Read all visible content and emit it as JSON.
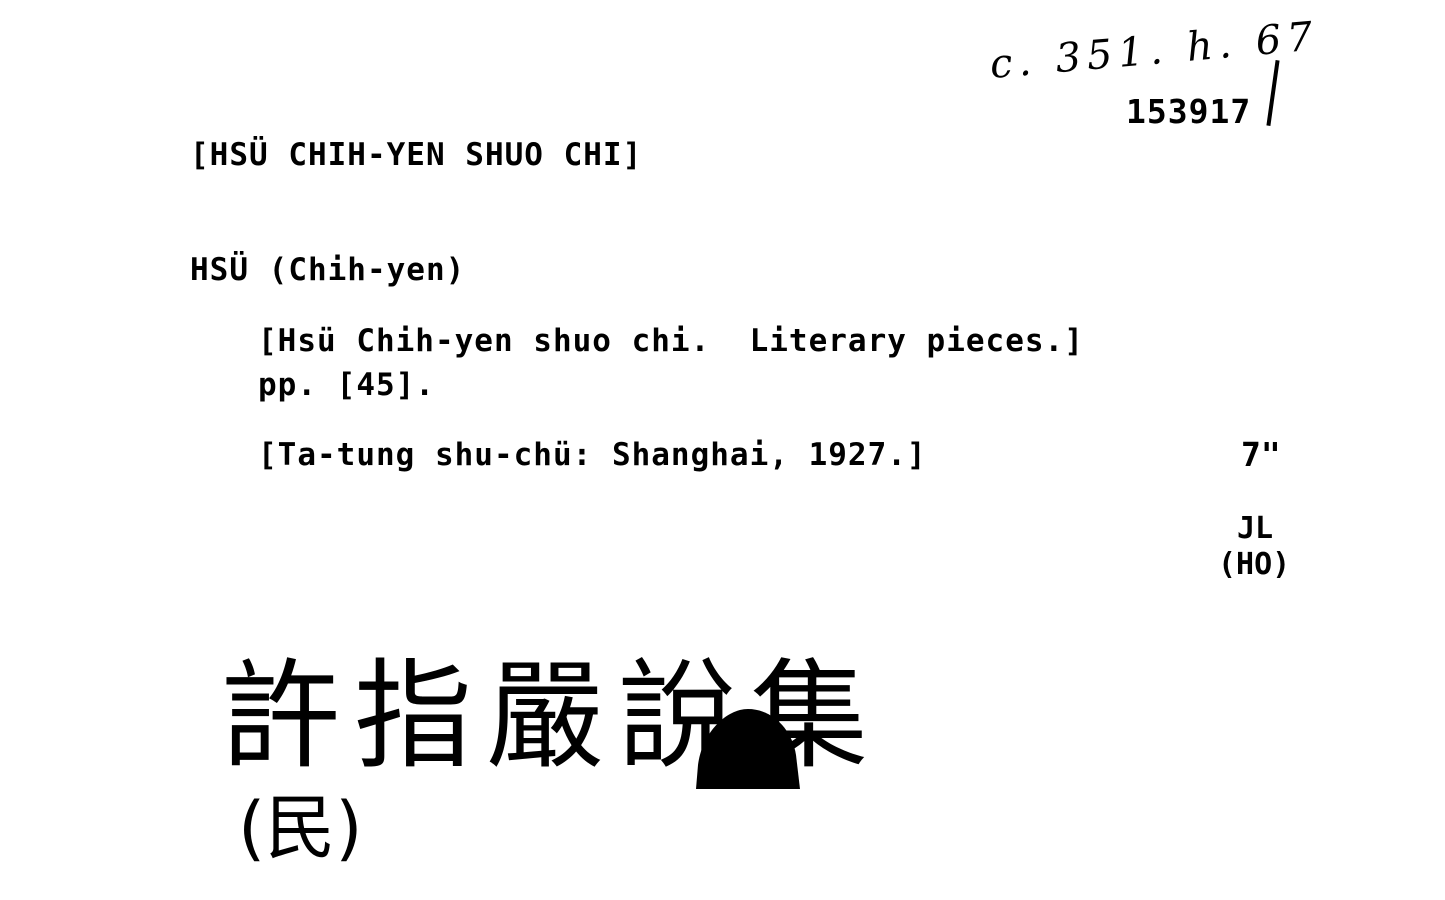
{
  "card": {
    "shelfmark": "c. 351. h. 67",
    "accession_number": "153917",
    "heading": "[HSÜ CHIH-YEN SHUO CHI]",
    "author": "HSÜ (Chih-yen)",
    "title": "[Hsü Chih-yen shuo chi.  Literary pieces.]",
    "pagination": "pp. [45].",
    "imprint": "[Ta-tung shu-chü: Shanghai, 1927.]",
    "size": "7\"",
    "cataloguer_initials": "JL",
    "cataloguer_code": "(HO)",
    "chinese_title": "許指嚴說集",
    "chinese_note": "(民)"
  }
}
